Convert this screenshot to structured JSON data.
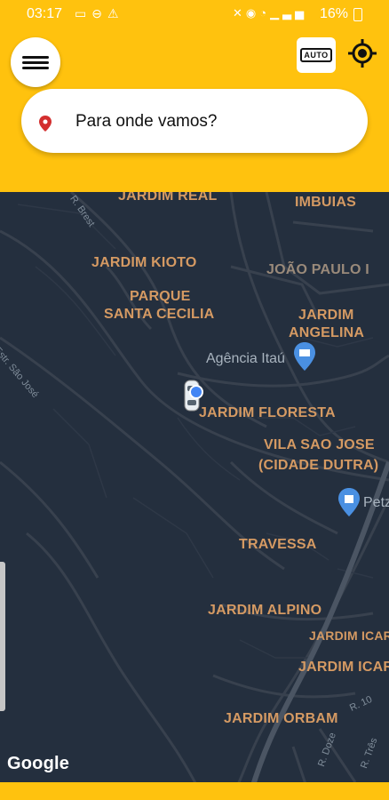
{
  "status_bar": {
    "time": "03:17",
    "battery": "16%"
  },
  "header": {
    "auto_label": "AUTO",
    "search_placeholder": "Para onde vamos?"
  },
  "map": {
    "neighborhoods": [
      "JARDIM REAL",
      "IMBUIAS",
      "JARDIM KIOTO",
      "JOÃO PAULO I",
      "PARQUE",
      "SANTA CECILIA",
      "JARDIM",
      "ANGELINA",
      "JARDIM FLORESTA",
      "VILA SAO JOSE",
      "(CIDADE DUTRA)",
      "TRAVESSA",
      "JARDIM ALPINO",
      "JARDIM ICAR",
      "JARDIM ICAR",
      "JARDIM ORBAM"
    ],
    "pois": [
      "Agência Itaú",
      "Petz"
    ],
    "roads": [
      "Estr. São José",
      "R. Brest",
      "R. 10",
      "R. Doze",
      "R. Três"
    ],
    "attribution": "Google"
  },
  "colors": {
    "header_yellow": "#ffc20e",
    "map_background": "#242f3e",
    "label_color": "#d59a63",
    "pin_red": "#d32f2f",
    "poi_blue": "#4a90e2"
  }
}
